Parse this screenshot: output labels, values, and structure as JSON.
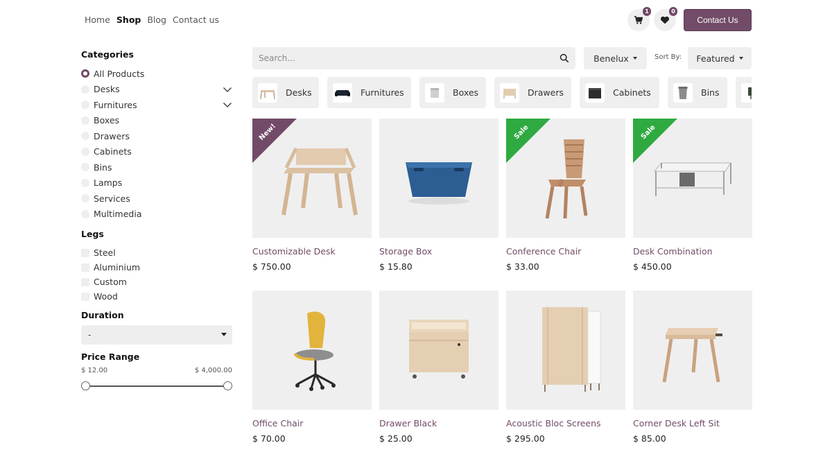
{
  "nav": {
    "items": [
      {
        "label": "Home"
      },
      {
        "label": "Shop"
      },
      {
        "label": "Blog"
      },
      {
        "label": "Contact us"
      }
    ]
  },
  "header": {
    "cart_count": "1",
    "wishlist_count": "0",
    "contact_button": "Contact Us",
    "accent_color": "#714b67"
  },
  "sidebar": {
    "categories_title": "Categories",
    "categories": [
      {
        "label": "All Products",
        "selected": true
      },
      {
        "label": "Desks",
        "expandable": true
      },
      {
        "label": "Furnitures",
        "expandable": true
      },
      {
        "label": "Boxes"
      },
      {
        "label": "Drawers"
      },
      {
        "label": "Cabinets"
      },
      {
        "label": "Bins"
      },
      {
        "label": "Lamps"
      },
      {
        "label": "Services"
      },
      {
        "label": "Multimedia"
      }
    ],
    "legs_title": "Legs",
    "legs": [
      {
        "label": "Steel"
      },
      {
        "label": "Aluminium"
      },
      {
        "label": "Custom"
      },
      {
        "label": "Wood"
      }
    ],
    "duration_title": "Duration",
    "duration_value": "-",
    "price_title": "Price Range",
    "price_min": "$ 12.00",
    "price_max": "$ 4,000.00"
  },
  "toolbar": {
    "search_placeholder": "Search...",
    "pricelist": "Benelux",
    "sort_label": "Sort By:",
    "sort_value": "Featured"
  },
  "chips": [
    {
      "label": "Desks"
    },
    {
      "label": "Furnitures"
    },
    {
      "label": "Boxes"
    },
    {
      "label": "Drawers"
    },
    {
      "label": "Cabinets"
    },
    {
      "label": "Bins"
    }
  ],
  "products": [
    {
      "name": "Customizable Desk",
      "price": "$ 750.00",
      "ribbon": "New!"
    },
    {
      "name": "Storage Box",
      "price": "$ 15.80",
      "ribbon": ""
    },
    {
      "name": "Conference Chair",
      "price": "$ 33.00",
      "ribbon": "Sale"
    },
    {
      "name": "Desk Combination",
      "price": "$ 450.00",
      "ribbon": "Sale"
    },
    {
      "name": "Office Chair",
      "price": "$ 70.00",
      "ribbon": ""
    },
    {
      "name": "Drawer Black",
      "price": "$ 25.00",
      "ribbon": ""
    },
    {
      "name": "Acoustic Bloc Screens",
      "price": "$ 295.00",
      "ribbon": ""
    },
    {
      "name": "Corner Desk Left Sit",
      "price": "$ 85.00",
      "ribbon": ""
    }
  ]
}
